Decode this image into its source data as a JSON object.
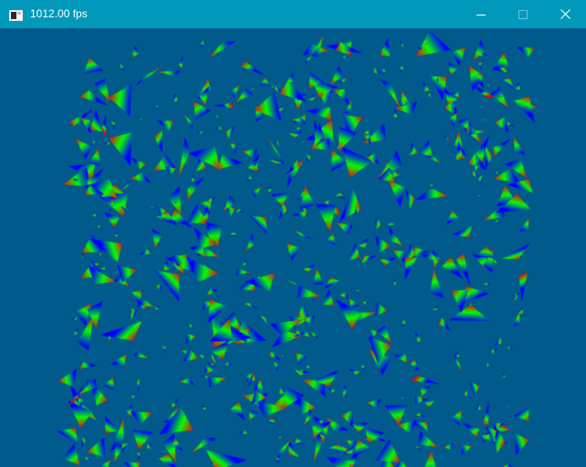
{
  "window": {
    "title": "1012.00 fps",
    "icon": "console-window-icon",
    "buttons": [
      "minimize-icon",
      "maximize-icon",
      "close-icon"
    ]
  },
  "colors": {
    "titlebar": "#0099bc",
    "background": "#005a8c",
    "triangle_vertices": [
      "#ff0000",
      "#00ff00",
      "#0000ff"
    ]
  }
}
